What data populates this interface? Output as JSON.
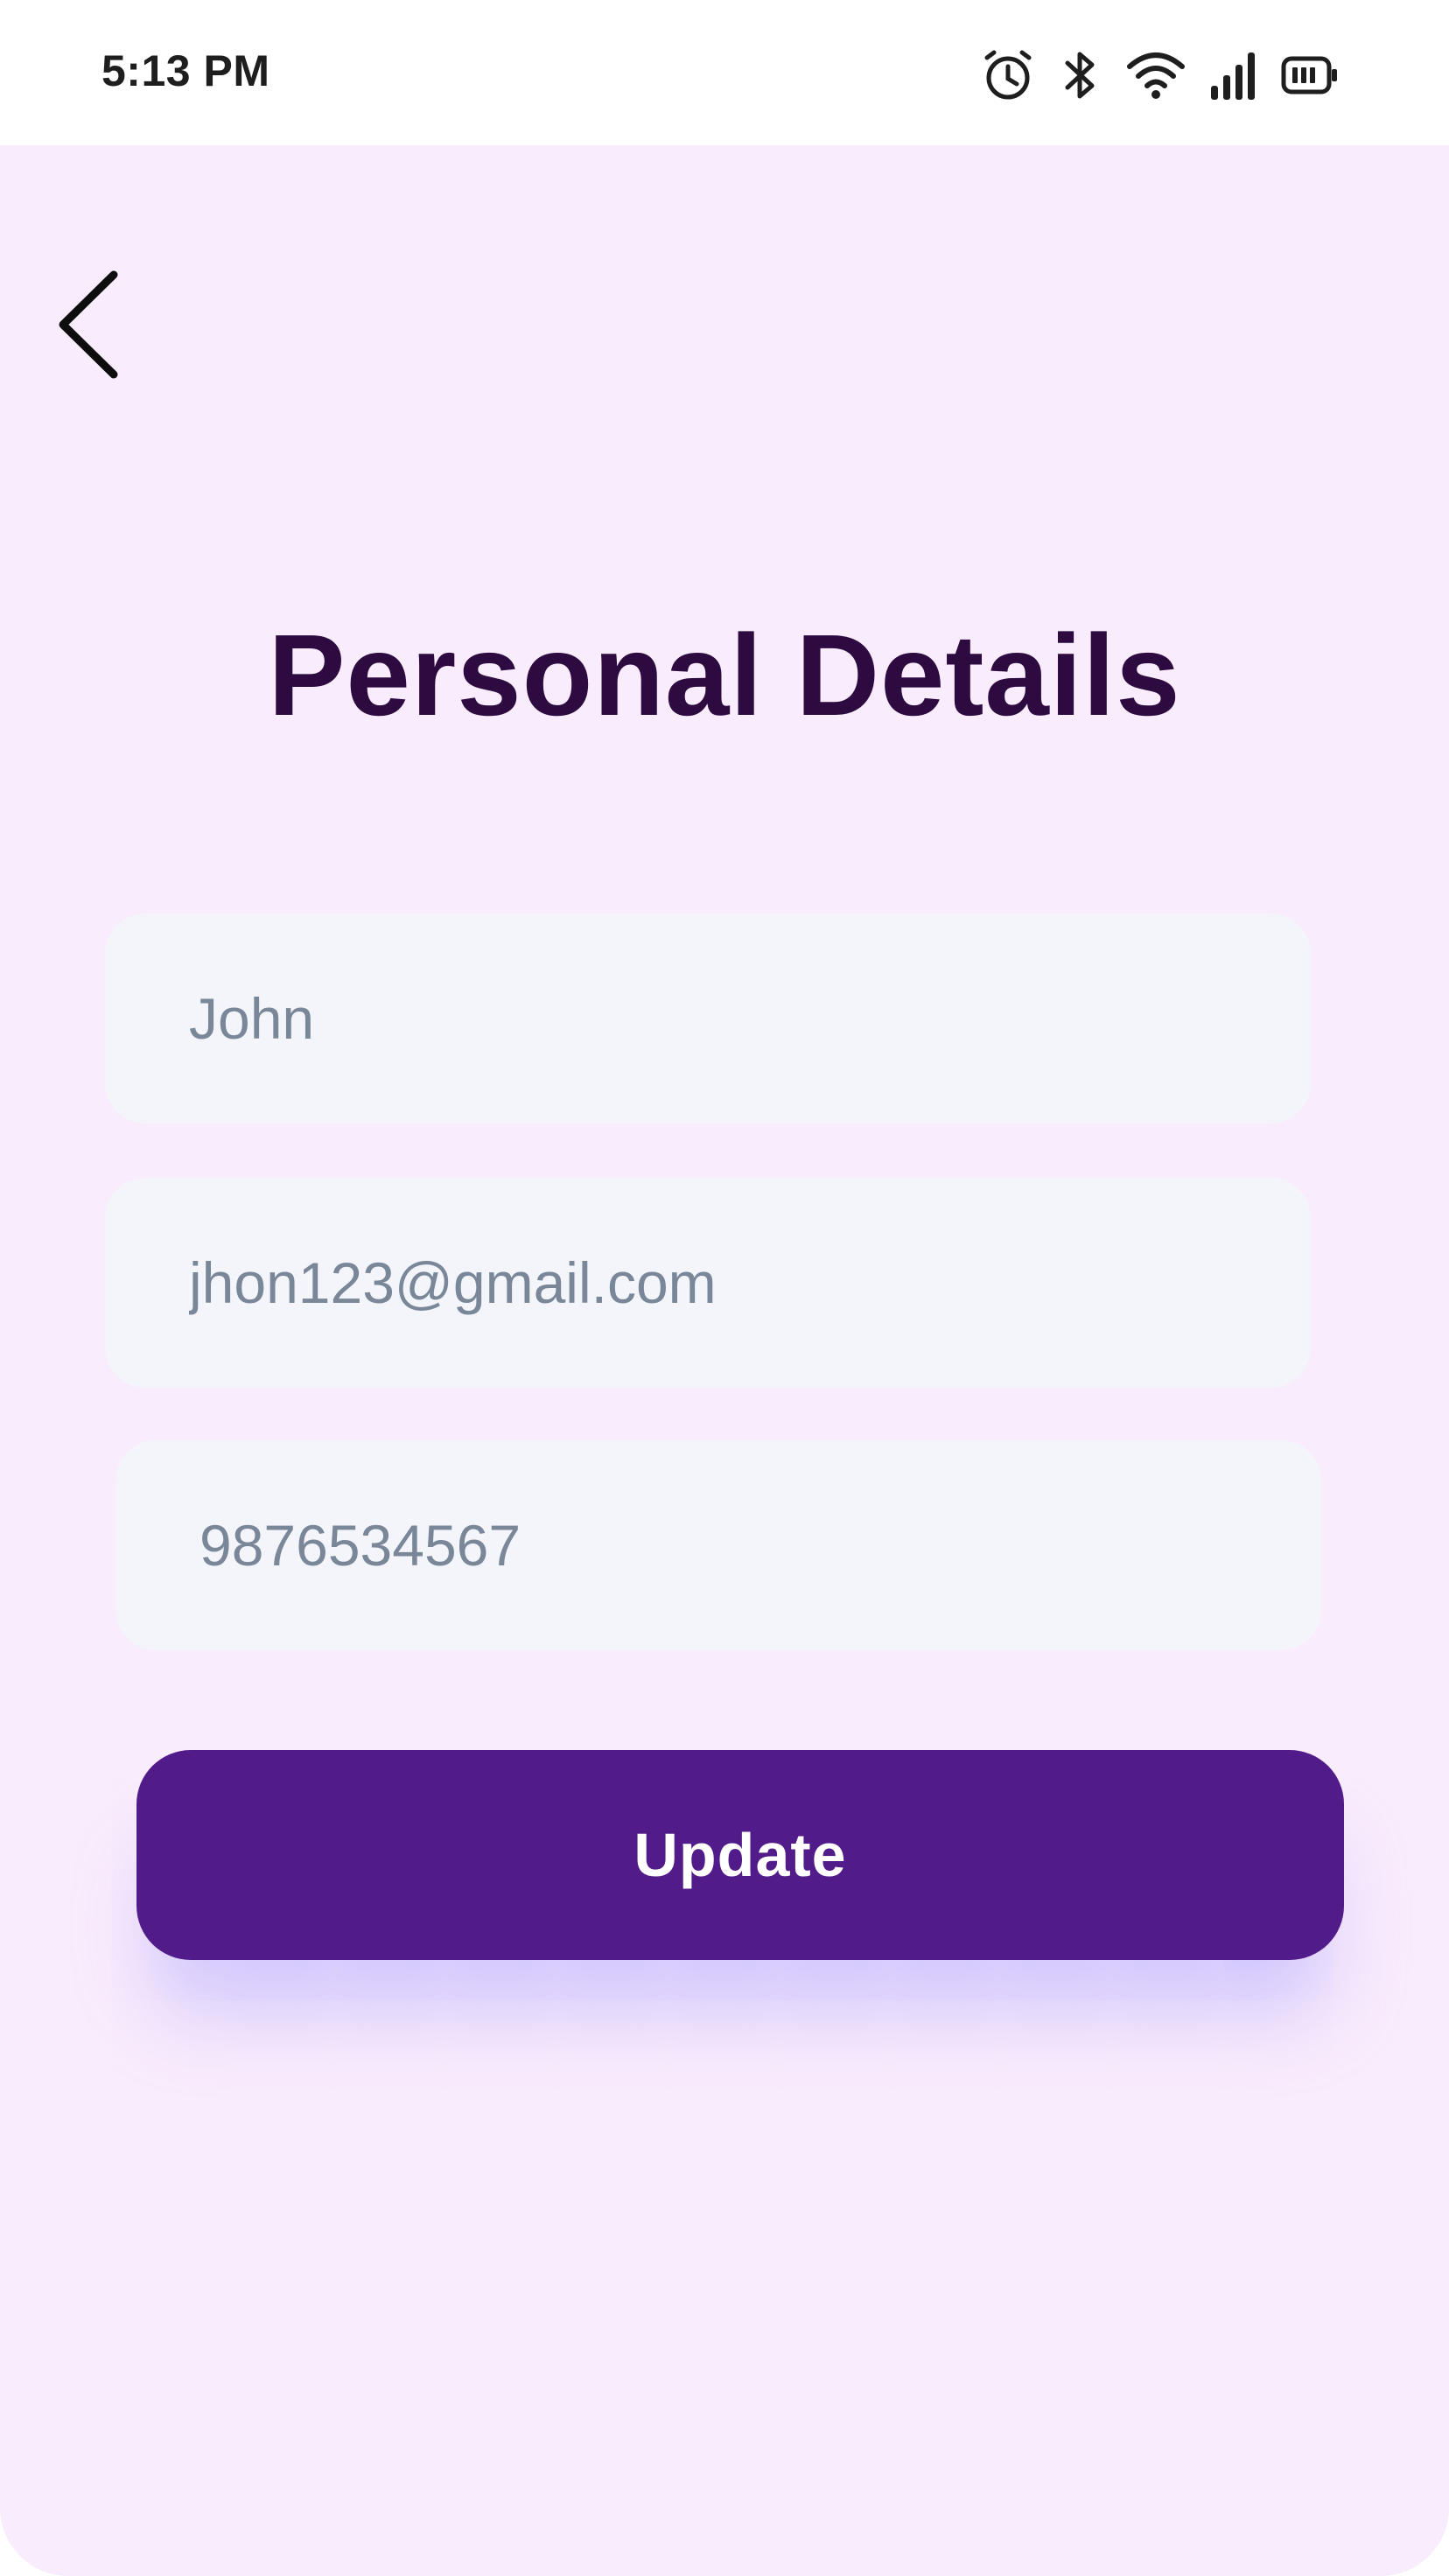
{
  "status_bar": {
    "time": "5:13 PM",
    "icons": [
      "alarm-icon",
      "bluetooth-icon",
      "wifi-icon",
      "signal-icon",
      "battery-icon"
    ]
  },
  "header": {
    "back_icon": "chevron-left-icon"
  },
  "page": {
    "title": "Personal Details"
  },
  "form": {
    "name_value": "John",
    "email_value": "jhon123@gmail.com",
    "phone_value": "9876534567",
    "update_label": "Update"
  },
  "colors": {
    "background": "#f9ecfc",
    "title": "#2d0a40",
    "field_bg": "#f3f5fb",
    "field_text": "#7a8799",
    "button_bg": "#521b8a",
    "button_text": "#ffffff"
  }
}
